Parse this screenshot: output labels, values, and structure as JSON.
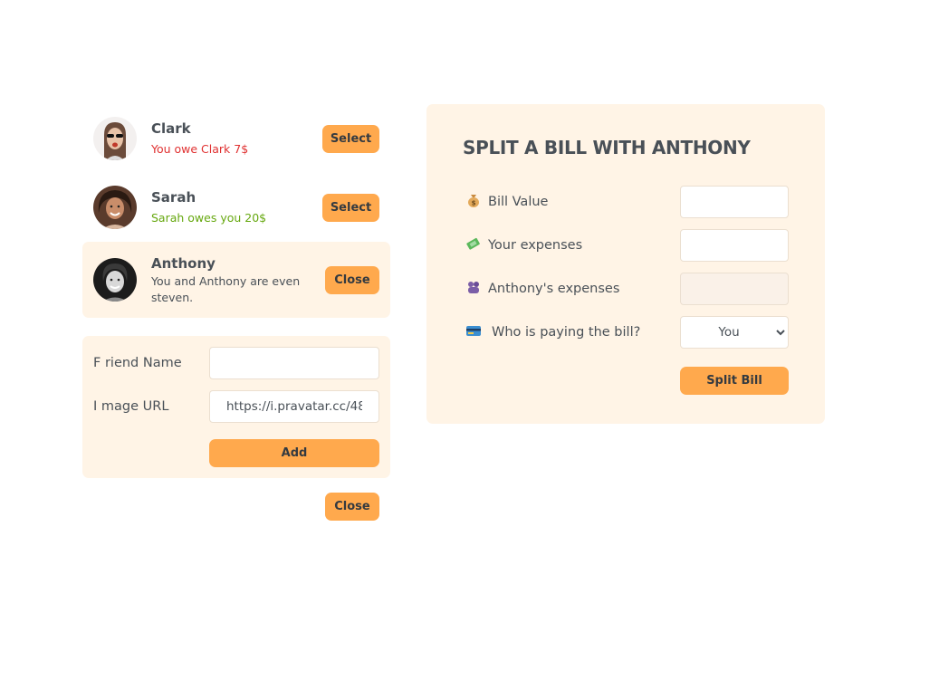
{
  "friends": [
    {
      "name": "Clark",
      "status": "You owe Clark 7$",
      "status_type": "red",
      "button": "Select"
    },
    {
      "name": "Sarah",
      "status": "Sarah owes you 20$",
      "status_type": "green",
      "button": "Select"
    },
    {
      "name": "Anthony",
      "status": "You and Anthony are even steven.",
      "status_type": "neutral",
      "button": "Close"
    }
  ],
  "add_form": {
    "name_label": "F riend Name",
    "name_value": "",
    "image_label": "I mage URL",
    "image_value": "https://i.pravatar.cc/48",
    "add_label": "Add"
  },
  "sidebar_close_label": "Close",
  "split_form": {
    "title": "SPLIT A BILL WITH ANTHONY",
    "bill_label": "Bill Value",
    "bill_icon": "money-bag-icon",
    "bill_value": "",
    "your_label": "Your expenses",
    "your_icon": "money-with-wings-icon",
    "your_value": "",
    "friend_label": "Anthony's expenses",
    "friend_icon": "purple-person-icon",
    "friend_value": "",
    "payer_label": "Who is paying the bill?",
    "payer_icon": "credit-card-icon",
    "payer_selected": "You",
    "split_label": "Split Bill"
  },
  "colors": {
    "accent": "#ffa94d",
    "panel": "#fff4e6",
    "owe": "#e03131",
    "owed": "#66a80f",
    "text": "#495057"
  }
}
